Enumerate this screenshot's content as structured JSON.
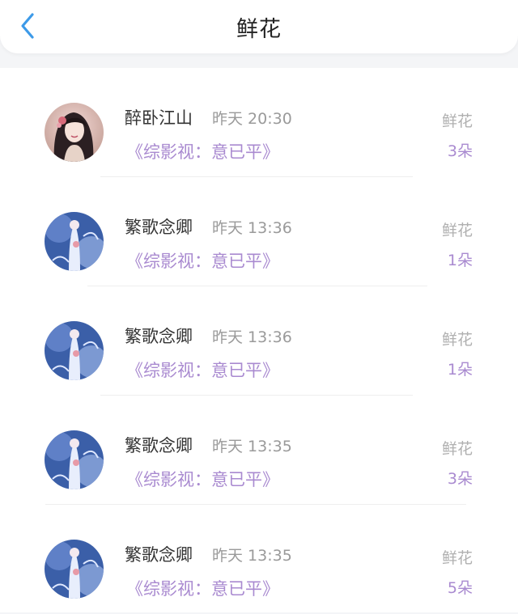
{
  "header": {
    "title": "鲜花",
    "back_icon": "chevron-left-icon",
    "accent_color": "#3d9ae8"
  },
  "records": [
    {
      "user": "醉卧江山",
      "time": "昨天 20:30",
      "book": "《综影视：意已平》",
      "gift": "鲜花",
      "count": "3朵",
      "avatar": "avatar-woman-dark-hair"
    },
    {
      "user": "繁歌念卿",
      "time": "昨天 13:36",
      "book": "《综影视：意已平》",
      "gift": "鲜花",
      "count": "1朵",
      "avatar": "avatar-blue-fantasy"
    },
    {
      "user": "繁歌念卿",
      "time": "昨天 13:36",
      "book": "《综影视：意已平》",
      "gift": "鲜花",
      "count": "1朵",
      "avatar": "avatar-blue-fantasy"
    },
    {
      "user": "繁歌念卿",
      "time": "昨天 13:35",
      "book": "《综影视：意已平》",
      "gift": "鲜花",
      "count": "3朵",
      "avatar": "avatar-blue-fantasy"
    },
    {
      "user": "繁歌念卿",
      "time": "昨天 13:35",
      "book": "《综影视：意已平》",
      "gift": "鲜花",
      "count": "5朵",
      "avatar": "avatar-blue-fantasy"
    }
  ],
  "colors": {
    "book_link": "#a98ad0",
    "count": "#a98ad0",
    "muted": "#9a9a9a"
  }
}
